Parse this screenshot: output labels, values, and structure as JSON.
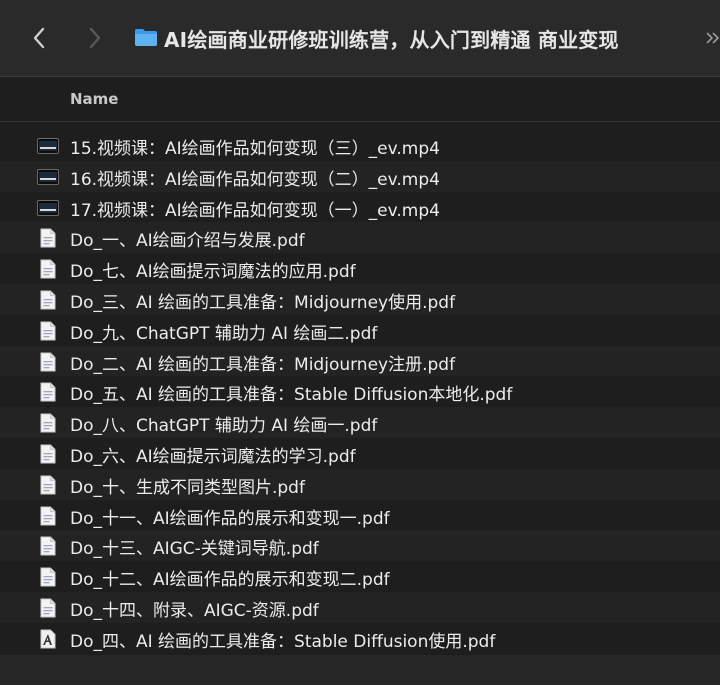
{
  "window": {
    "title": "AI绘画商业研修班训练营，从入门到精通 商业变现",
    "back_icon": "chevron-left-icon",
    "forward_icon": "chevron-right-icon",
    "folder_icon": "folder-icon",
    "accent": "#3b9be8"
  },
  "list_header": {
    "name_label": "Name"
  },
  "files": [
    {
      "name": "15.视频课：AI绘画作品如何变现（三）_ev.mp4",
      "kind": "video"
    },
    {
      "name": "16.视频课：AI绘画作品如何变现（二）_ev.mp4",
      "kind": "video"
    },
    {
      "name": "17.视频课：AI绘画作品如何变现（一）_ev.mp4",
      "kind": "video"
    },
    {
      "name": "Do_一、AI绘画介绍与发展.pdf",
      "kind": "pdf"
    },
    {
      "name": "Do_七、AI绘画提示词魔法的应用.pdf",
      "kind": "pdf"
    },
    {
      "name": "Do_三、AI 绘画的工具准备：Midjourney使用.pdf",
      "kind": "pdf"
    },
    {
      "name": "Do_九、ChatGPT 辅助力 AI 绘画二.pdf",
      "kind": "pdf"
    },
    {
      "name": "Do_二、AI 绘画的工具准备：Midjourney注册.pdf",
      "kind": "pdf"
    },
    {
      "name": "Do_五、AI 绘画的工具准备：Stable Diffusion本地化.pdf",
      "kind": "pdf"
    },
    {
      "name": "Do_八、ChatGPT 辅助力 AI 绘画一.pdf",
      "kind": "pdf"
    },
    {
      "name": "Do_六、AI绘画提示词魔法的学习.pdf",
      "kind": "pdf"
    },
    {
      "name": "Do_十、生成不同类型图片.pdf",
      "kind": "pdf"
    },
    {
      "name": "Do_十一、AI绘画作品的展示和变现一.pdf",
      "kind": "pdf"
    },
    {
      "name": "Do_十三、AIGC-关键词导航.pdf",
      "kind": "pdf"
    },
    {
      "name": "Do_十二、AI绘画作品的展示和变现二.pdf",
      "kind": "pdf"
    },
    {
      "name": "Do_十四、附录、AIGC-资源.pdf",
      "kind": "pdf"
    },
    {
      "name": "Do_四、AI 绘画的工具准备：Stable Diffusion使用.pdf",
      "kind": "pdf-app"
    }
  ]
}
